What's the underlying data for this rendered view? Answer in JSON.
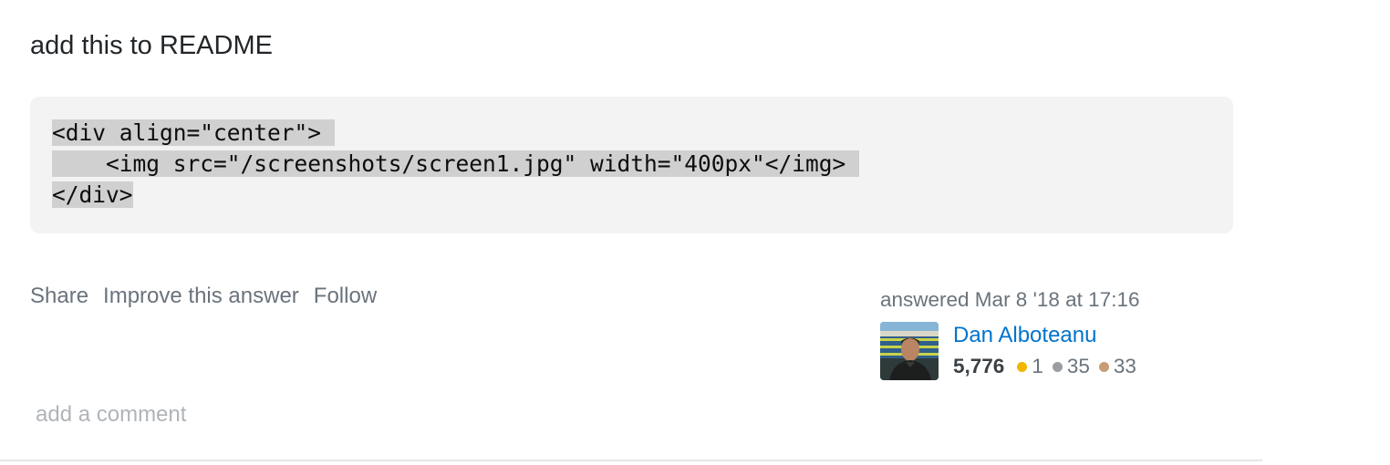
{
  "intro_text": "add this to README",
  "code": {
    "line1": "<div align=\"center\"> ",
    "line2": "    <img src=\"/screenshots/screen1.jpg\" width=\"400px\"</img> ",
    "line3": "</div>"
  },
  "post_menu": {
    "share": "Share",
    "improve": "Improve this answer",
    "follow": "Follow"
  },
  "user_info": {
    "action_time": "answered Mar 8 '18 at 17:16",
    "name": "Dan Alboteanu",
    "reputation": "5,776",
    "gold_count": "1",
    "silver_count": "35",
    "bronze_count": "33",
    "gold_color": "#f1b600",
    "silver_color": "#9a9ea2",
    "bronze_color": "#c79d77"
  },
  "add_comment": "add a comment"
}
